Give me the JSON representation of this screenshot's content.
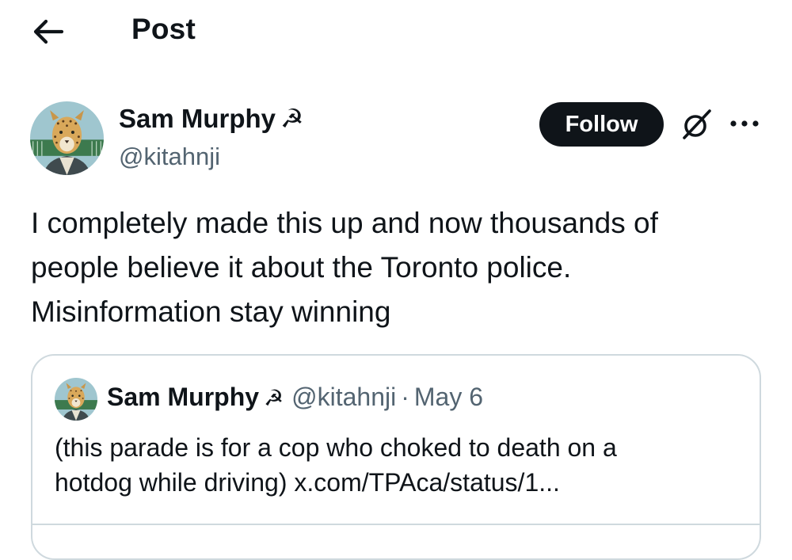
{
  "header": {
    "back_icon": "arrow-left-icon",
    "title": "Post"
  },
  "post": {
    "author": {
      "name": "Sam Murphy",
      "name_emoji": "☭",
      "handle": "@kitahnji",
      "avatar_icon": "leopard-avatar"
    },
    "follow_label": "Follow",
    "grok_icon": "grok-icon",
    "more_icon": "more-horizontal-icon",
    "text_lines": [
      "I completely made this up and now thousands of",
      "people believe it about the Toronto police.",
      "Misinformation stay winning"
    ]
  },
  "quote": {
    "author_name": "Sam Murphy",
    "author_emoji": "☭",
    "handle": "@kitahnji",
    "separator": "·",
    "date": "May 6",
    "text_line1": "(this parade is for a cop who choked to death on a",
    "text_line2_prefix": "hotdog while driving) ",
    "link": "x.com/TPAca/status/1..."
  },
  "colors": {
    "text_primary": "#0f1419",
    "text_secondary": "#536471",
    "border": "#cfd9de",
    "follow_bg": "#0f1419",
    "follow_text": "#ffffff"
  }
}
